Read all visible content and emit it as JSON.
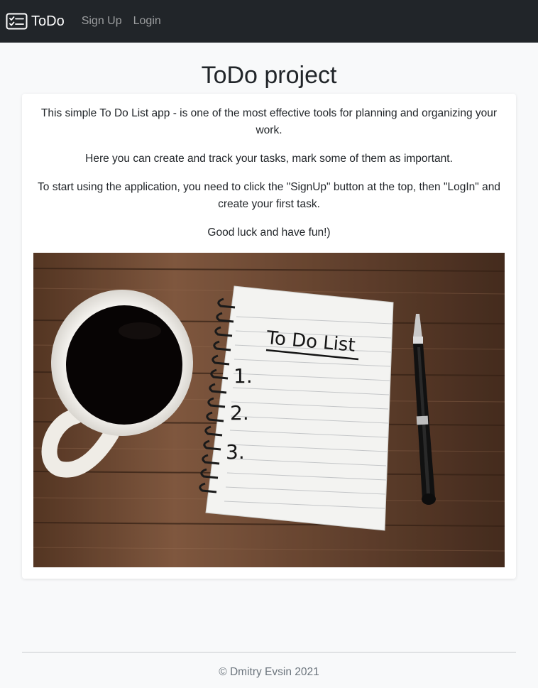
{
  "navbar": {
    "brand_icon": "checklist-icon",
    "brand_label": "ToDo",
    "links": [
      {
        "label": "Sign Up"
      },
      {
        "label": "Login"
      }
    ],
    "background": "#212529"
  },
  "main": {
    "title": "ToDo project",
    "paragraphs": [
      "This simple To Do List app - is one of the most effective tools for planning and organizing your work.",
      "Here you can create and track your tasks, mark some of them as important.",
      "To start using the application, you need to click the \"SignUp\" button at the top, then \"LogIn\" and create your first task.",
      "Good luck and have fun!)"
    ],
    "hero_image": {
      "notebook_heading": "To Do List",
      "list_numbers": [
        "1.",
        "2.",
        "3."
      ]
    }
  },
  "footer": {
    "text": "© Dmitry Evsin 2021"
  }
}
